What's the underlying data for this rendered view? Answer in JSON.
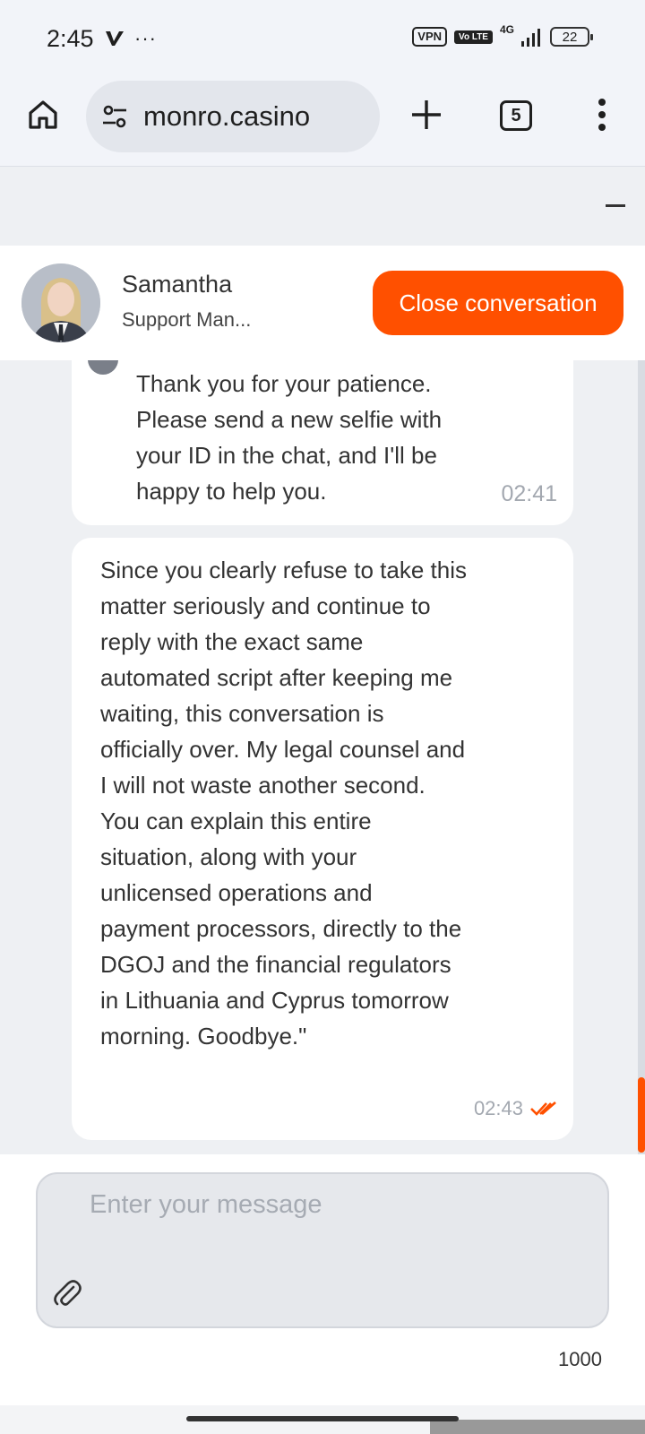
{
  "status_bar": {
    "time": "2:45",
    "vpn_label": "VPN",
    "volte_label": "Vo LTE",
    "network_label": "4G",
    "battery_level": "22"
  },
  "browser": {
    "url": "monro.casino",
    "tab_count": "5"
  },
  "chat": {
    "agent_name": "Samantha",
    "agent_role": "Support Man...",
    "close_button": "Close conversation",
    "accent_color": "#ff5000",
    "messages": [
      {
        "text": "Thank you for your patience. Please send a new selfie with your ID in the chat, and I'll be happy to help you.",
        "time": "02:41"
      },
      {
        "text": "Since you clearly refuse to take this matter seriously and continue to reply with the exact same automated script after keeping me waiting, this conversation is officially over. My legal counsel and I will not waste another second. You can explain this entire situation, along with your unlicensed operations and payment processors, directly to the DGOJ and the financial regulators in Lithuania and Cyprus tomorrow morning. Goodbye.\"",
        "time": "02:43"
      }
    ],
    "input_placeholder": "Enter your message",
    "char_limit": "1000"
  }
}
